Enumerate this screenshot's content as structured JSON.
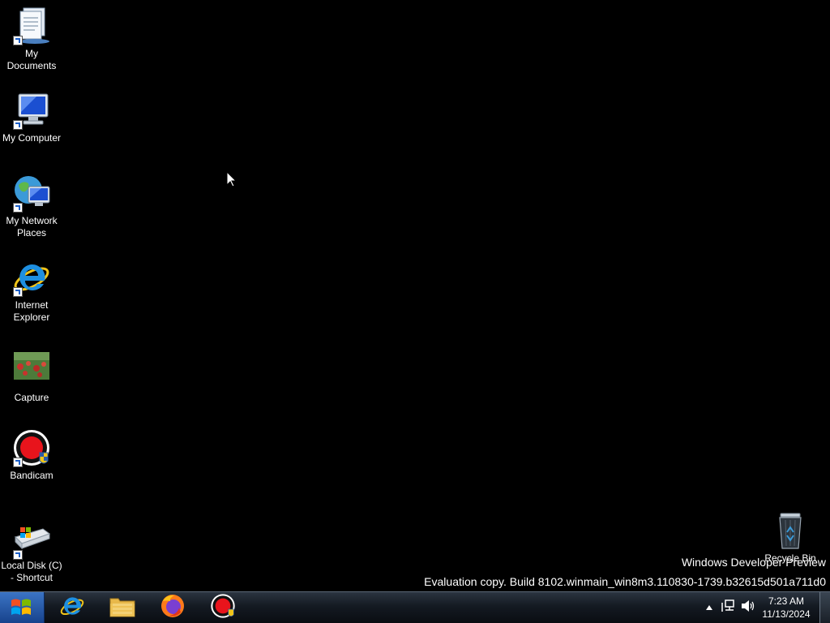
{
  "desktop": {
    "icons": [
      {
        "label": "My\nDocuments",
        "icon": "documents-icon"
      },
      {
        "label": "My Computer",
        "icon": "computer-icon"
      },
      {
        "label": "My Network\nPlaces",
        "icon": "network-icon"
      },
      {
        "label": "Internet\nExplorer",
        "icon": "internet-explorer-icon"
      },
      {
        "label": "Capture",
        "icon": "image-thumbnail-icon"
      },
      {
        "label": "Bandicam",
        "icon": "bandicam-icon"
      },
      {
        "label": "Local Disk (C)\n- Shortcut",
        "icon": "drive-icon"
      }
    ],
    "recycle_bin": {
      "label": "Recycle Bin",
      "icon": "recycle-bin-icon"
    },
    "watermark": {
      "line1": "Windows Developer Preview",
      "line2": "Evaluation copy. Build 8102.winmain_win8m3.110830-1739.b32615d501a711d0"
    }
  },
  "taskbar": {
    "start": {
      "icon": "windows-logo-icon"
    },
    "pinned": [
      {
        "name": "Internet Explorer",
        "icon": "internet-explorer-icon"
      },
      {
        "name": "Windows Explorer",
        "icon": "folder-icon"
      },
      {
        "name": "Firefox",
        "icon": "firefox-icon"
      },
      {
        "name": "Bandicam",
        "icon": "bandicam-icon"
      }
    ],
    "tray": {
      "time": "7:23 AM",
      "date": "11/13/2024"
    }
  },
  "colors": {
    "desktop_bg": "#000000",
    "taskbar_bg": "#141a22",
    "bandicam_red": "#e8141c",
    "ie_blue": "#1e8fe0"
  }
}
